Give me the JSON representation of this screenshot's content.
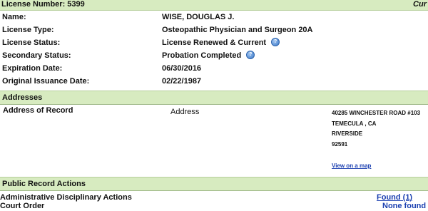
{
  "license_header": {
    "license_number": "License Number: 5399",
    "current_date_fragment": "Cur"
  },
  "details": {
    "rows": [
      {
        "label": "Name:",
        "value": "WISE, DOUGLAS J.",
        "help": false
      },
      {
        "label": "License Type:",
        "value": "Osteopathic Physician and Surgeon 20A",
        "help": false
      },
      {
        "label": "License Status:",
        "value": "License Renewed & Current",
        "help": true
      },
      {
        "label": "Secondary Status:",
        "value": "Probation Completed",
        "help": true
      },
      {
        "label": "Expiration Date:",
        "value": "06/30/2016",
        "help": false
      },
      {
        "label": "Original Issuance Date:",
        "value": "02/22/1987",
        "help": false
      }
    ],
    "help_icon": "help-question-icon"
  },
  "addresses": {
    "section_title": "Addresses",
    "record_label": "Address of Record",
    "type_label": "Address",
    "lines": [
      "40285 WINCHESTER ROAD #103",
      "TEMECULA , CA",
      "RIVERSIDE",
      "92591"
    ],
    "map_link": "View on a map"
  },
  "public_record": {
    "section_title": "Public Record Actions",
    "actions": [
      {
        "label": "Administrative Disciplinary Actions",
        "result": "Found (1)"
      },
      {
        "label": "Court Order",
        "result": "None found"
      }
    ]
  },
  "colors": {
    "header_bg": "#d7ebc0",
    "link": "#1a3fb0"
  }
}
